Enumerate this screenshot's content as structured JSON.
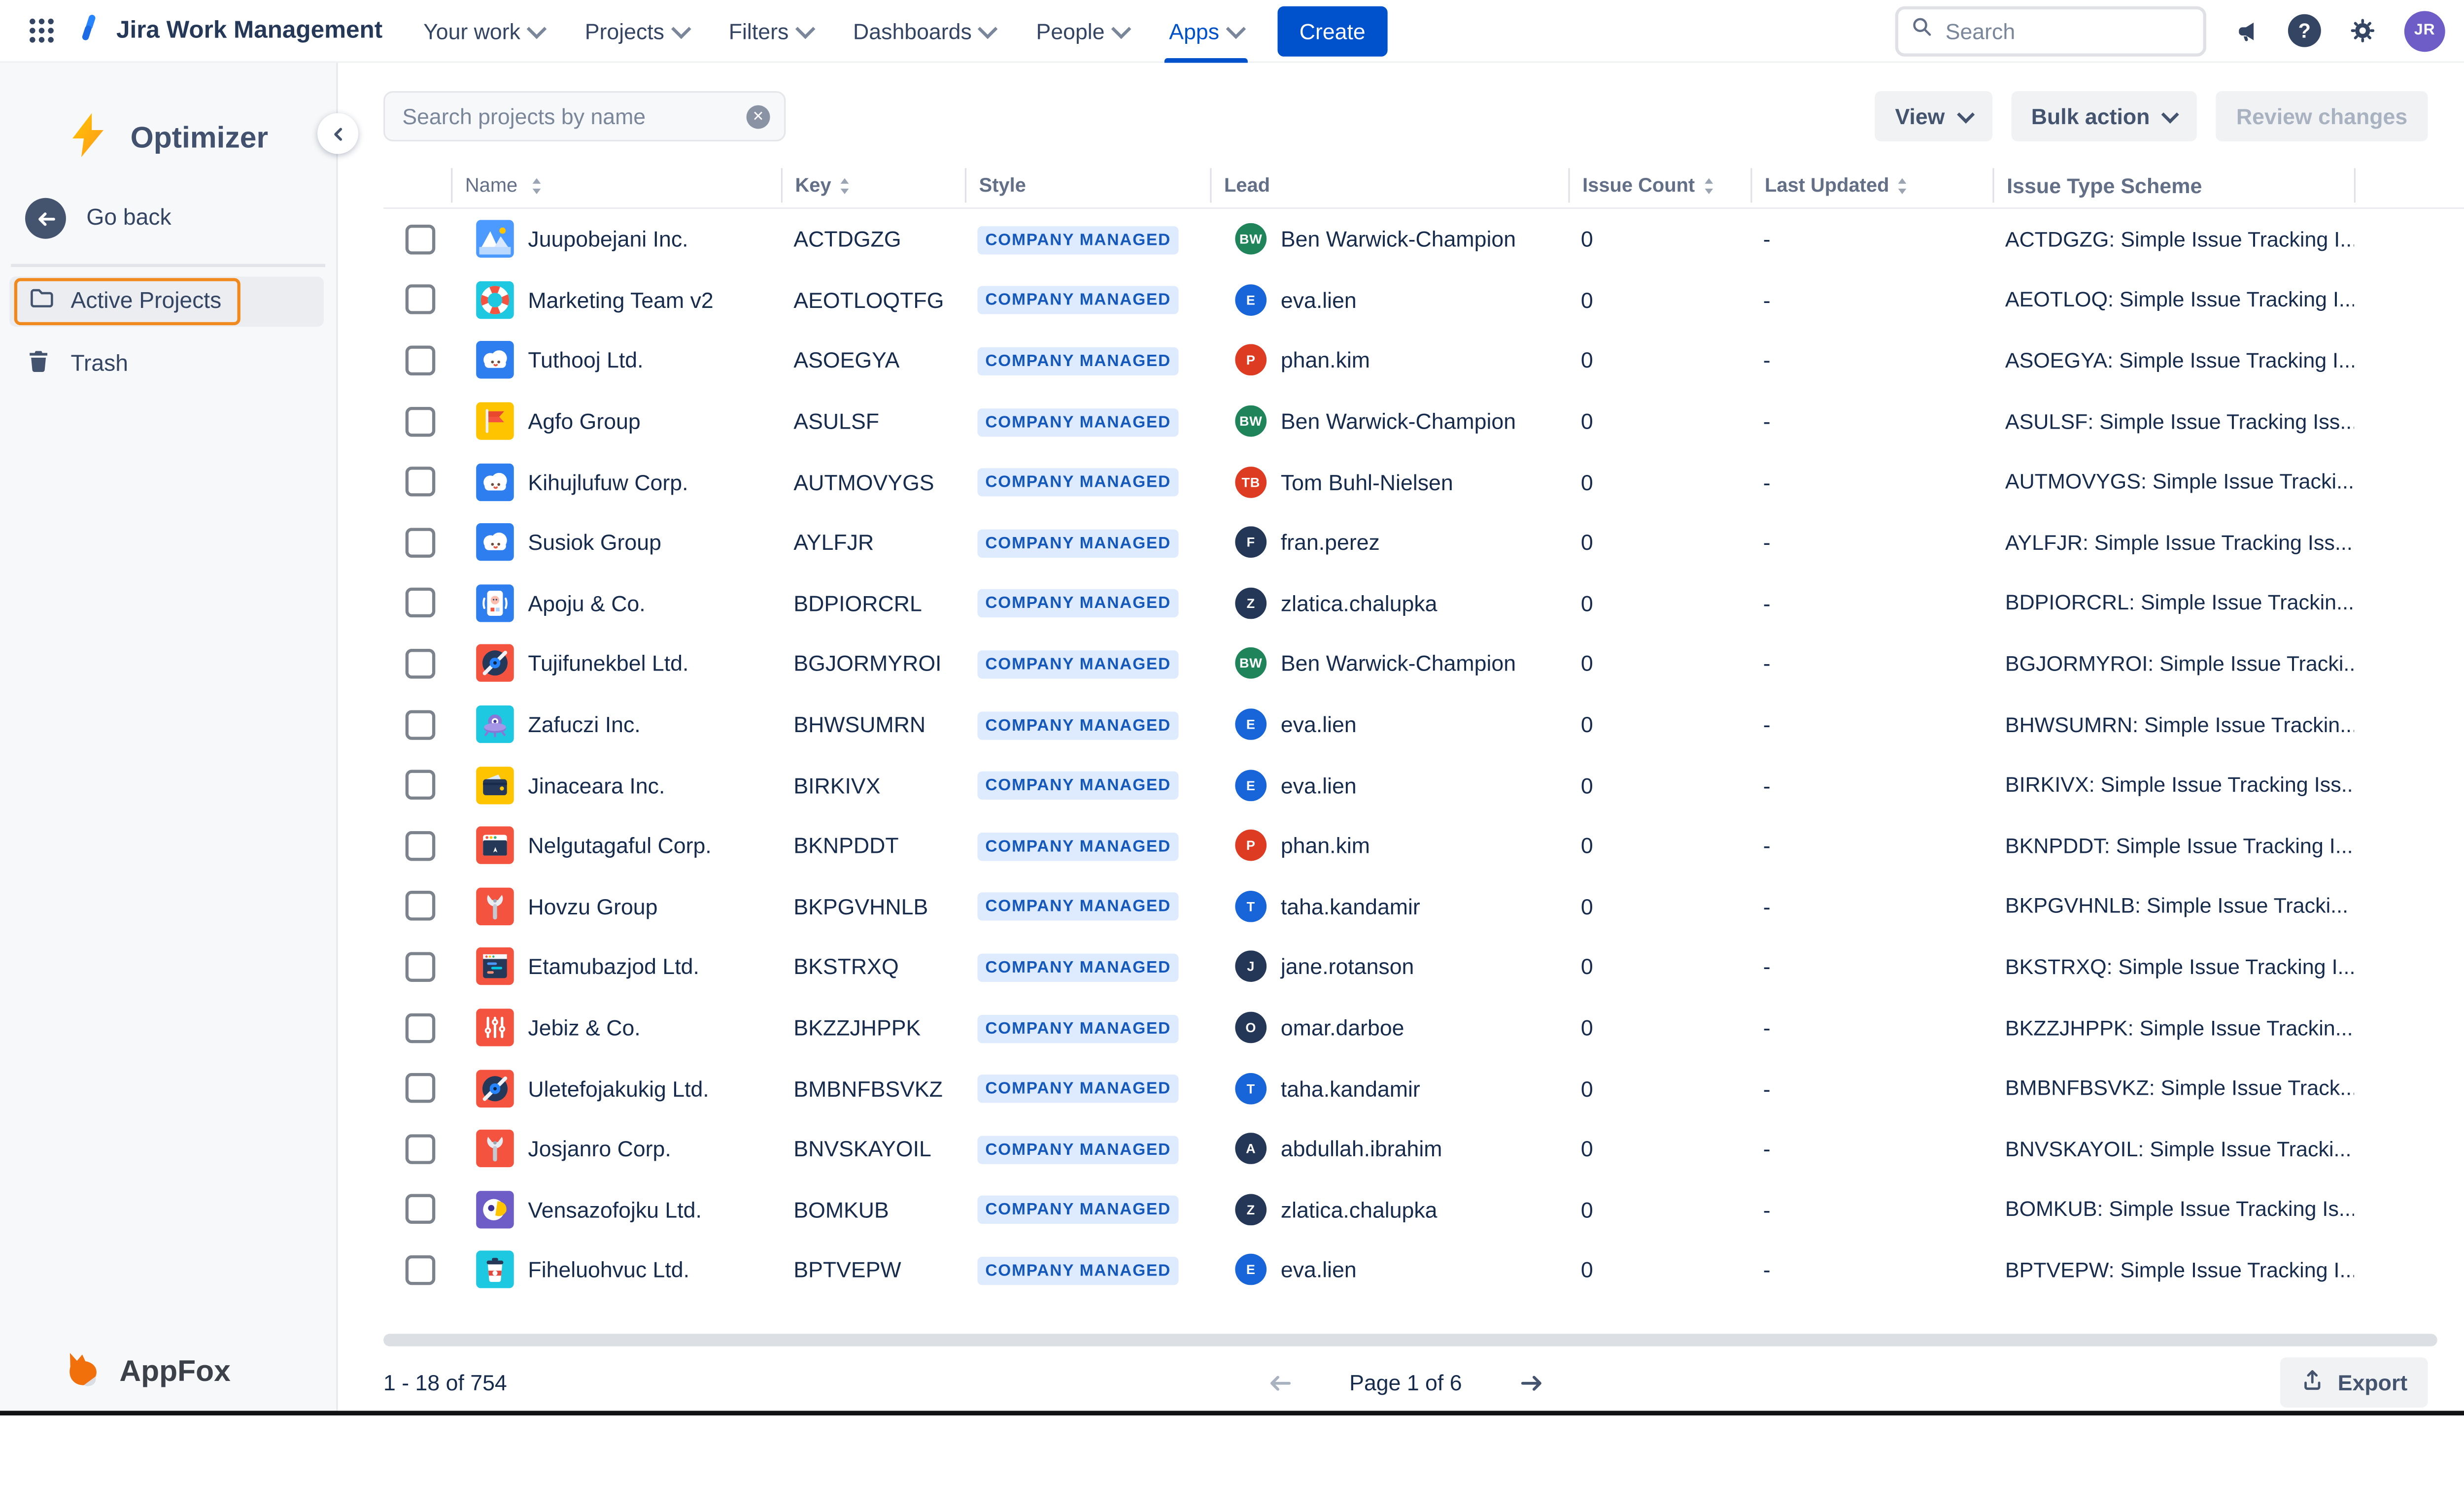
{
  "navbar": {
    "product_title": "Jira Work Management",
    "menu": [
      {
        "label": "Your work",
        "has_chevron": true,
        "active": false
      },
      {
        "label": "Projects",
        "has_chevron": true,
        "active": false
      },
      {
        "label": "Filters",
        "has_chevron": true,
        "active": false
      },
      {
        "label": "Dashboards",
        "has_chevron": true,
        "active": false
      },
      {
        "label": "People",
        "has_chevron": true,
        "active": false
      },
      {
        "label": "Apps",
        "has_chevron": true,
        "active": true
      }
    ],
    "create_label": "Create",
    "search_placeholder": "Search",
    "avatar_initials": "JR",
    "icons": [
      "app-switcher-grid",
      "announcements-megaphone",
      "help-question-circle",
      "settings-gear"
    ]
  },
  "sidebar": {
    "app_name": "Optimizer",
    "go_back_label": "Go back",
    "items": [
      {
        "label": "Active Projects",
        "icon": "folder",
        "active": true
      },
      {
        "label": "Trash",
        "icon": "trash-can",
        "active": false
      }
    ],
    "footer_brand": "AppFox",
    "highlight_color": "#F18A1E"
  },
  "toolbar": {
    "search_placeholder": "Search projects by name",
    "view_label": "View",
    "bulk_action_label": "Bulk action",
    "review_changes_label": "Review changes",
    "review_changes_disabled": true
  },
  "table": {
    "badge_label": "COMPANY MANAGED",
    "badge_bg": "#DEEBFF",
    "badge_text_color": "#1558BC",
    "columns": [
      {
        "label": "Name",
        "cls": "c-name",
        "sortable": true
      },
      {
        "label": "Key",
        "cls": "c-key",
        "sortable": true
      },
      {
        "label": "Style",
        "cls": "c-style",
        "sortable": false
      },
      {
        "label": "Lead",
        "cls": "c-lead",
        "sortable": false
      },
      {
        "label": "Issue Count",
        "cls": "c-count",
        "sortable": true
      },
      {
        "label": "Last Updated",
        "cls": "c-updated",
        "sortable": true
      },
      {
        "label": "Issue Type Scheme",
        "cls": "c-scheme",
        "sortable": false
      }
    ],
    "rows": [
      {
        "name": "Juupobejani Inc.",
        "icon": "mountain",
        "icon_bg": "#4C9AFF",
        "key": "ACTDGZG",
        "lead": "Ben Warwick-Champion",
        "lead_initials": "BW",
        "lead_color": "#1F845A",
        "issue_count": "0",
        "last_updated": "-",
        "issue_type_scheme": "ACTDGZG: Simple Issue Tracking I..."
      },
      {
        "name": "Marketing Team v2",
        "icon": "lifebuoy",
        "icon_bg": "#1EC8E0",
        "key": "AEOTLOQTFG",
        "lead": "eva.lien",
        "lead_initials": "E",
        "lead_color": "#1765D8",
        "issue_count": "0",
        "last_updated": "-",
        "issue_type_scheme": "AEOTLOQ: Simple Issue Tracking I..."
      },
      {
        "name": "Tuthooj Ltd.",
        "icon": "cloud",
        "icon_bg": "#2E7EF0",
        "key": "ASOEGYA",
        "lead": "phan.kim",
        "lead_initials": "P",
        "lead_color": "#DE3B23",
        "issue_count": "0",
        "last_updated": "-",
        "issue_type_scheme": "ASOEGYA: Simple Issue Tracking I..."
      },
      {
        "name": "Agfo Group",
        "icon": "flag",
        "icon_bg": "#FFC400",
        "key": "ASULSF",
        "lead": "Ben Warwick-Champion",
        "lead_initials": "BW",
        "lead_color": "#1F845A",
        "issue_count": "0",
        "last_updated": "-",
        "issue_type_scheme": "ASULSF: Simple Issue Tracking Iss..."
      },
      {
        "name": "Kihujlufuw Corp.",
        "icon": "cloud",
        "icon_bg": "#2E7EF0",
        "key": "AUTMOVYGS",
        "lead": "Tom Buhl-Nielsen",
        "lead_initials": "TB",
        "lead_color": "#DE3B23",
        "issue_count": "0",
        "last_updated": "-",
        "issue_type_scheme": "AUTMOVYGS: Simple Issue Tracki..."
      },
      {
        "name": "Susiok Group",
        "icon": "cloud",
        "icon_bg": "#2E7EF0",
        "key": "AYLFJR",
        "lead": "fran.perez",
        "lead_initials": "F",
        "lead_color": "#243757",
        "issue_count": "0",
        "last_updated": "-",
        "issue_type_scheme": "AYLFJR: Simple Issue Tracking Iss..."
      },
      {
        "name": "Apoju & Co.",
        "icon": "phone",
        "icon_bg": "#2E7EF0",
        "key": "BDPIORCRL",
        "lead": "zlatica.chalupka",
        "lead_initials": "Z",
        "lead_color": "#243757",
        "issue_count": "0",
        "last_updated": "-",
        "issue_type_scheme": "BDPIORCRL: Simple Issue Trackin..."
      },
      {
        "name": "Tujifunekbel Ltd.",
        "icon": "vinyl",
        "icon_bg": "#F4543F",
        "key": "BGJORMYROI",
        "lead": "Ben Warwick-Champion",
        "lead_initials": "BW",
        "lead_color": "#1F845A",
        "issue_count": "0",
        "last_updated": "-",
        "issue_type_scheme": "BGJORMYROI: Simple Issue Tracki..."
      },
      {
        "name": "Zafuczi Inc.",
        "icon": "ufo",
        "icon_bg": "#1EC8E0",
        "key": "BHWSUMRN",
        "lead": "eva.lien",
        "lead_initials": "E",
        "lead_color": "#1765D8",
        "issue_count": "0",
        "last_updated": "-",
        "issue_type_scheme": "BHWSUMRN: Simple Issue Trackin..."
      },
      {
        "name": "Jinaceara Inc.",
        "icon": "wallet",
        "icon_bg": "#FFC400",
        "key": "BIRKIVX",
        "lead": "eva.lien",
        "lead_initials": "E",
        "lead_color": "#1765D8",
        "issue_count": "0",
        "last_updated": "-",
        "issue_type_scheme": "BIRKIVX: Simple Issue Tracking Iss..."
      },
      {
        "name": "Nelgutagaful Corp.",
        "icon": "browser",
        "icon_bg": "#F4543F",
        "key": "BKNPDDT",
        "lead": "phan.kim",
        "lead_initials": "P",
        "lead_color": "#DE3B23",
        "issue_count": "0",
        "last_updated": "-",
        "issue_type_scheme": "BKNPDDT: Simple Issue Tracking I..."
      },
      {
        "name": "Hovzu Group",
        "icon": "wrench",
        "icon_bg": "#F4543F",
        "key": "BKPGVHNLB",
        "lead": "taha.kandamir",
        "lead_initials": "T",
        "lead_color": "#1765D8",
        "issue_count": "0",
        "last_updated": "-",
        "issue_type_scheme": "BKPGVHNLB: Simple Issue Tracki..."
      },
      {
        "name": "Etamubazjod Ltd.",
        "icon": "code",
        "icon_bg": "#F4543F",
        "key": "BKSTRXQ",
        "lead": "jane.rotanson",
        "lead_initials": "J",
        "lead_color": "#243757",
        "issue_count": "0",
        "last_updated": "-",
        "issue_type_scheme": "BKSTRXQ: Simple Issue Tracking I..."
      },
      {
        "name": "Jebiz & Co.",
        "icon": "sliders",
        "icon_bg": "#F4543F",
        "key": "BKZZJHPPK",
        "lead": "omar.darboe",
        "lead_initials": "O",
        "lead_color": "#243757",
        "issue_count": "0",
        "last_updated": "-",
        "issue_type_scheme": "BKZZJHPPK: Simple Issue Trackin..."
      },
      {
        "name": "Uletefojakukig Ltd.",
        "icon": "vinyl",
        "icon_bg": "#F4543F",
        "key": "BMBNFBSVKZ",
        "lead": "taha.kandamir",
        "lead_initials": "T",
        "lead_color": "#1765D8",
        "issue_count": "0",
        "last_updated": "-",
        "issue_type_scheme": "BMBNFBSVKZ: Simple Issue Track..."
      },
      {
        "name": "Josjanro Corp.",
        "icon": "wrench",
        "icon_bg": "#F4543F",
        "key": "BNVSKAYOIL",
        "lead": "abdullah.ibrahim",
        "lead_initials": "A",
        "lead_color": "#243757",
        "issue_count": "0",
        "last_updated": "-",
        "issue_type_scheme": "BNVSKAYOIL: Simple Issue Tracki..."
      },
      {
        "name": "Vensazofojku Ltd.",
        "icon": "parrot",
        "icon_bg": "#6E5DC6",
        "key": "BOMKUB",
        "lead": "zlatica.chalupka",
        "lead_initials": "Z",
        "lead_color": "#243757",
        "issue_count": "0",
        "last_updated": "-",
        "issue_type_scheme": "BOMKUB: Simple Issue Tracking Is..."
      },
      {
        "name": "Fiheluohvuc Ltd.",
        "icon": "coffee",
        "icon_bg": "#1EC8E0",
        "key": "BPTVEPW",
        "lead": "eva.lien",
        "lead_initials": "E",
        "lead_color": "#1765D8",
        "issue_count": "0",
        "last_updated": "-",
        "issue_type_scheme": "BPTVEPW: Simple Issue Tracking I..."
      }
    ]
  },
  "footer": {
    "range_label": "1 - 18 of 754",
    "page_label": "Page 1 of 6",
    "export_label": "Export"
  },
  "colors": {
    "accent_blue": "#0052CC",
    "text_dark": "#172B4D",
    "header_gray": "#626F86",
    "sidebar_bg": "#F7F8F9",
    "highlight_orange": "#F18A1E"
  }
}
